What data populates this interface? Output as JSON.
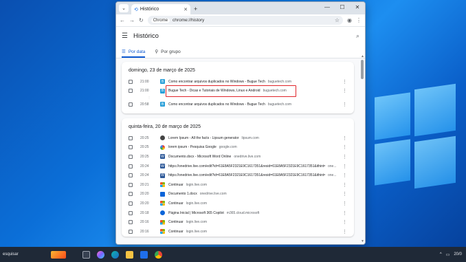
{
  "browser": {
    "tab_title": "Histórico",
    "site_chip": "Chrome",
    "url": "chrome://history"
  },
  "history": {
    "title": "Histórico",
    "tabs": [
      {
        "label": "Por data",
        "active": true
      },
      {
        "label": "Por grupo",
        "active": false
      }
    ],
    "groups": [
      {
        "date": "domingo, 23 de março de 2025",
        "items": [
          {
            "time": "21:00",
            "title": "Como encontrar arquivos duplicados no Windows - Bugue Tech",
            "domain": "buguetech.com",
            "icon": "bt"
          },
          {
            "time": "21:00",
            "title": "Bugue Tech - Dicas e Tutoriais de Windows, Linux e Android",
            "domain": "buguetech.com",
            "icon": "bt",
            "highlighted": true
          },
          {
            "time": "20:58",
            "title": "Como encontrar arquivos duplicados no Windows - Bugue Tech",
            "domain": "buguetech.com",
            "icon": "bt"
          }
        ]
      },
      {
        "date": "quinta-feira, 20 de março de 2025",
        "items": [
          {
            "time": "20:25",
            "title": "Lorem Ipsum - All the facts - Lipsum generator",
            "domain": "lipsum.com",
            "icon": "lip"
          },
          {
            "time": "20:25",
            "title": "lorem ipsum - Pesquisa Google",
            "domain": "google.com",
            "icon": "g"
          },
          {
            "time": "20:25",
            "title": "Documento.docx - Microsoft Word Online",
            "domain": "onedrive.live.com",
            "icon": "w"
          },
          {
            "time": "20:24",
            "title": "https://onedrive.live.com/edit?id=61E8A5F2321E9C1617351&resid=61E8A5F2321E9C1617351&ithint=file%2...",
            "domain": "one...",
            "icon": "w"
          },
          {
            "time": "20:24",
            "title": "https://onedrive.live.com/edit?id=61E8A5F2321E9C1617351&resid=61E8A5F2321E9C1617351&ithint=file%2...",
            "domain": "one...",
            "icon": "w"
          },
          {
            "time": "20:21",
            "title": "Continuar",
            "domain": "login.live.com",
            "icon": "ms"
          },
          {
            "time": "20:20",
            "title": "Documento 1.docx",
            "domain": "onedrive.live.com",
            "icon": "od"
          },
          {
            "time": "20:20",
            "title": "Continuar",
            "domain": "login.live.com",
            "icon": "ms"
          },
          {
            "time": "20:18",
            "title": "Página Inicial | Microsoft 365 Copilot",
            "domain": "m365.cloud.microsoft",
            "icon": "cl"
          },
          {
            "time": "20:16",
            "title": "Continuar",
            "domain": "login.live.com",
            "icon": "ms"
          },
          {
            "time": "20:16",
            "title": "Continuar",
            "domain": "login.live.com",
            "icon": "ms"
          }
        ]
      }
    ]
  },
  "taskbar": {
    "search_label": "esquisar",
    "clock": "20/0"
  }
}
